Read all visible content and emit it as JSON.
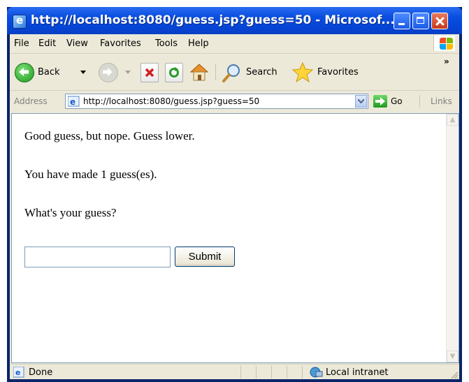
{
  "window": {
    "title": "http://localhost:8080/guess.jsp?guess=50 - Microsof...",
    "icon": "ie-icon",
    "controls": [
      "minimize-icon",
      "maximize-icon",
      "close-icon"
    ]
  },
  "menubar": {
    "items": [
      "File",
      "Edit",
      "View",
      "Favorites",
      "Tools",
      "Help"
    ]
  },
  "toolbar": {
    "back_label": "Back",
    "search_label": "Search",
    "favorites_label": "Favorites",
    "overflow": "»"
  },
  "addressbar": {
    "label": "Address",
    "url": "http://localhost:8080/guess.jsp?guess=50",
    "go_label": "Go",
    "links_label": "Links"
  },
  "page": {
    "message": "Good guess, but nope. Guess lower.",
    "count_text": "You have made 1 guess(es).",
    "prompt": "What's your guess?",
    "guess_value": "",
    "submit_label": "Submit"
  },
  "statusbar": {
    "status": "Done",
    "zone": "Local intranet"
  },
  "colors": {
    "titlebar": "#0545d8",
    "chrome": "#ece9d8",
    "border": "#7f9db9"
  }
}
